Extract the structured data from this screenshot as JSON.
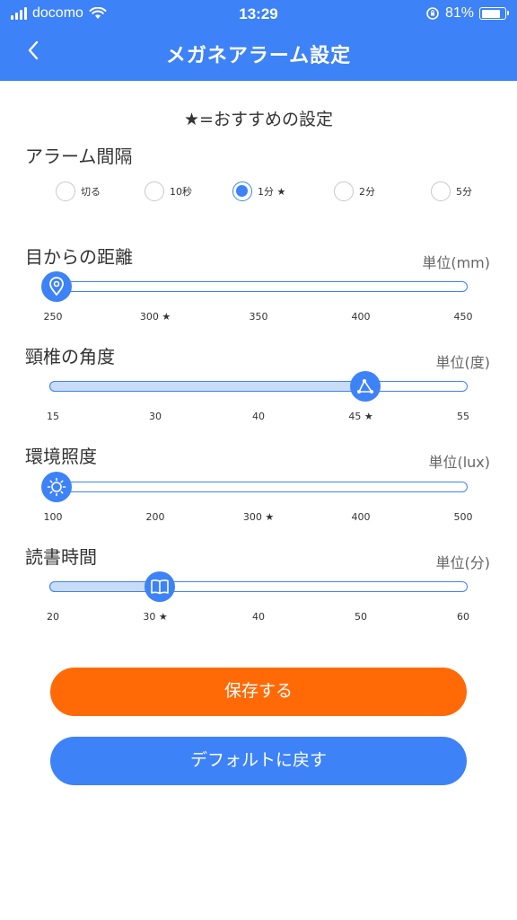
{
  "status_bar": {
    "carrier": "docomo",
    "time": "13:29",
    "battery": "81%"
  },
  "header": {
    "title": "メガネアラーム設定",
    "back_icon": "chevron-left-icon"
  },
  "legend": "★=おすすめの設定",
  "alarm_interval": {
    "label": "アラーム間隔",
    "options": [
      "切る",
      "10秒",
      "1分 ★",
      "2分",
      "5分"
    ],
    "selected_index": 2
  },
  "distance": {
    "label": "目からの距離",
    "unit": "単位(mm)",
    "ticks": [
      "250",
      "300 ★",
      "350",
      "400",
      "450"
    ],
    "min": 250,
    "max": 450,
    "value": 250,
    "icon": "map-pin-icon"
  },
  "neck_angle": {
    "label": "頸椎の角度",
    "unit": "単位(度)",
    "ticks": [
      "15",
      "30",
      "40",
      "45 ★",
      "55"
    ],
    "min": 15,
    "max": 55,
    "value": 45,
    "icon": "angle-icon"
  },
  "illuminance": {
    "label": "環境照度",
    "unit": "単位(lux)",
    "ticks": [
      "100",
      "200",
      "300 ★",
      "400",
      "500"
    ],
    "min": 100,
    "max": 500,
    "value": 100,
    "icon": "sun-icon"
  },
  "reading_time": {
    "label": "読書時間",
    "unit": "単位(分)",
    "ticks": [
      "20",
      "30 ★",
      "40",
      "50",
      "60"
    ],
    "min": 20,
    "max": 60,
    "value": 30,
    "icon": "book-icon"
  },
  "buttons": {
    "save": "保存する",
    "reset": "デフォルトに戻す"
  },
  "colors": {
    "primary": "#3d82f7",
    "save": "#ff6a06"
  }
}
